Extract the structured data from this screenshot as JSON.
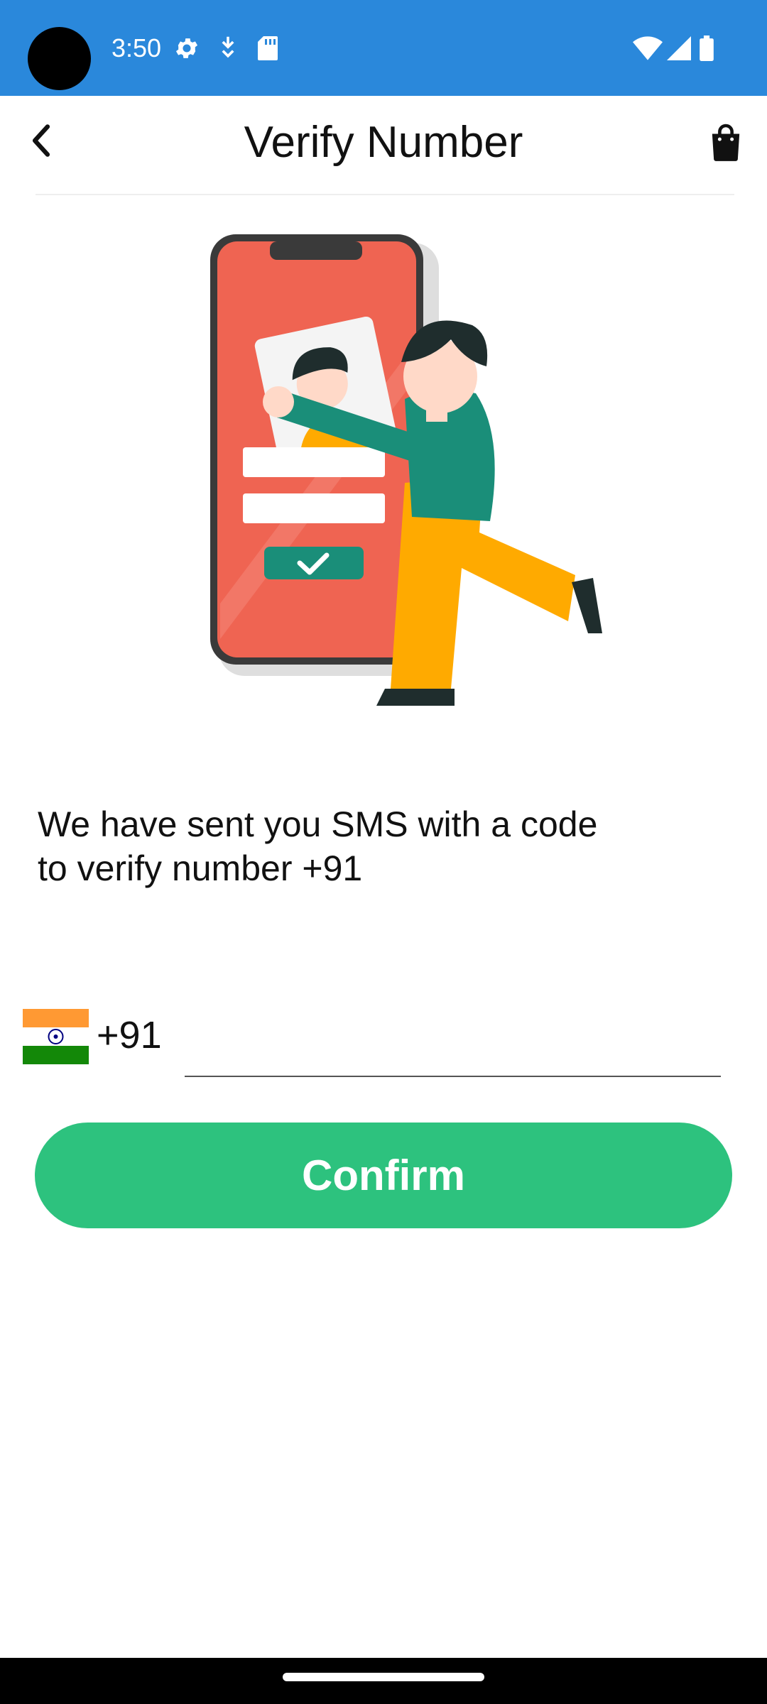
{
  "status_bar": {
    "time": "3:50",
    "background_color": "#2a88db",
    "icons_left": [
      "settings-gear-icon",
      "download-status-icon",
      "sd-card-icon"
    ],
    "icons_right": [
      "wifi-icon",
      "cellular-signal-icon",
      "battery-icon"
    ]
  },
  "header": {
    "title": "Verify Number",
    "back_icon": "chevron-left-icon",
    "cart_icon": "shopping-bag-icon"
  },
  "illustration": {
    "subject": "person-with-phone-verification-illustration"
  },
  "message": {
    "text": "We have sent you SMS with a code\nto verify number  +91"
  },
  "phone_input": {
    "country_flag": "india-flag-icon",
    "country_code": "+91",
    "value": "",
    "placeholder": ""
  },
  "confirm_button": {
    "label": "Confirm",
    "color": "#2dc27e"
  }
}
